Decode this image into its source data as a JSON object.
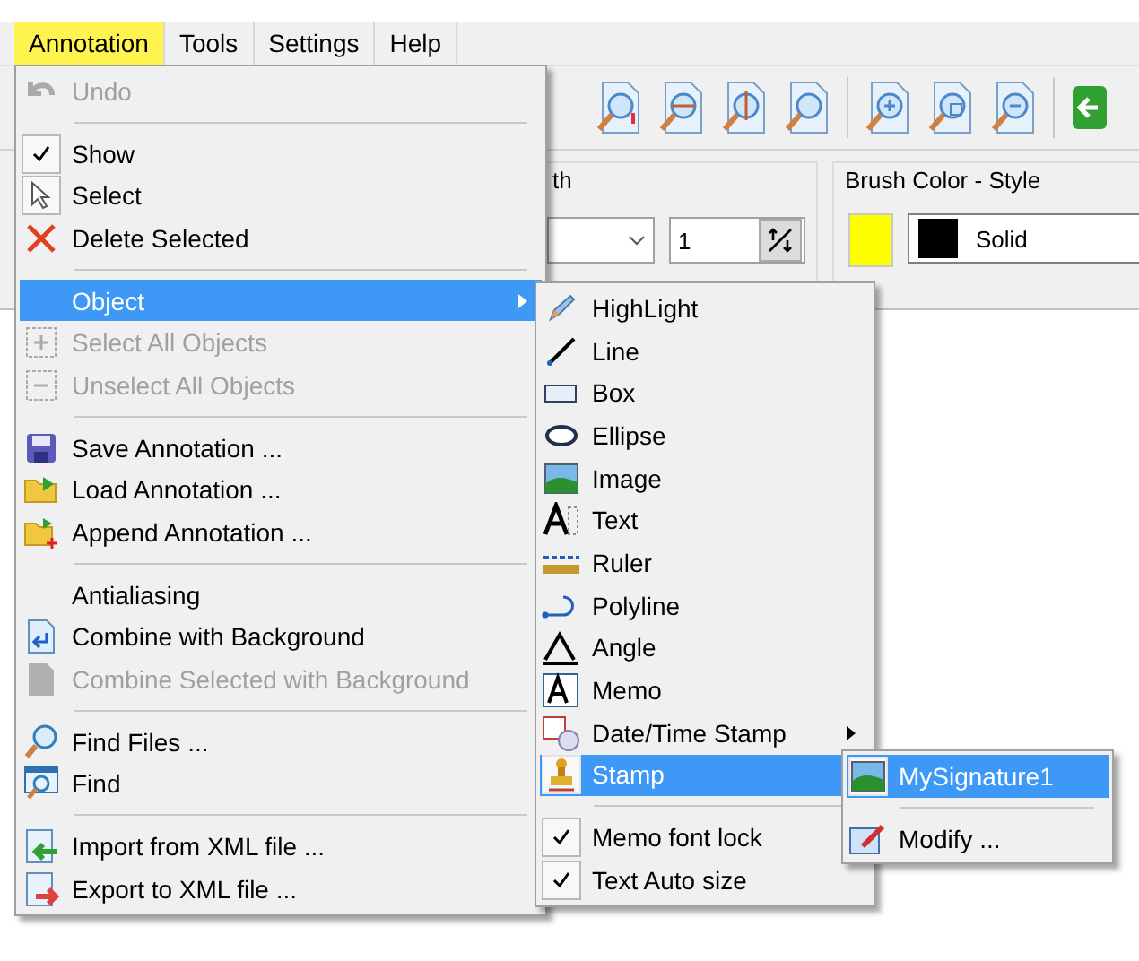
{
  "menubar": [
    {
      "label": "Annotation",
      "selected": true
    },
    {
      "label": "Tools",
      "selected": false
    },
    {
      "label": "Settings",
      "selected": false
    },
    {
      "label": "Help",
      "selected": false
    }
  ],
  "width_group": {
    "title": "th",
    "spin_value": "1"
  },
  "brush_group": {
    "title": "Brush Color - Style",
    "color": "#ffff00",
    "style": "Solid"
  },
  "annotation_menu": [
    {
      "kind": "item",
      "label": "Undo",
      "disabled": true,
      "checked": false,
      "selected": false
    },
    {
      "kind": "separator"
    },
    {
      "kind": "item",
      "label": "Show",
      "disabled": false,
      "checked": true,
      "selected": false
    },
    {
      "kind": "item",
      "label": "Select",
      "disabled": false,
      "checked": true,
      "selected": false
    },
    {
      "kind": "item",
      "label": "Delete Selected",
      "disabled": false,
      "checked": false,
      "selected": false
    },
    {
      "kind": "separator"
    },
    {
      "kind": "submenu",
      "label": "Object",
      "disabled": false,
      "checked": false,
      "selected": true
    },
    {
      "kind": "item",
      "label": "Select All Objects",
      "disabled": true,
      "checked": false,
      "selected": false
    },
    {
      "kind": "item",
      "label": "Unselect All Objects",
      "disabled": true,
      "checked": false,
      "selected": false
    },
    {
      "kind": "separator"
    },
    {
      "kind": "item",
      "label": "Save Annotation ...",
      "disabled": false,
      "checked": false,
      "selected": false
    },
    {
      "kind": "item",
      "label": "Load Annotation ...",
      "disabled": false,
      "checked": false,
      "selected": false
    },
    {
      "kind": "item",
      "label": "Append Annotation ...",
      "disabled": false,
      "checked": false,
      "selected": false
    },
    {
      "kind": "separator"
    },
    {
      "kind": "item",
      "label": "Antialiasing",
      "disabled": false,
      "checked": false,
      "selected": false
    },
    {
      "kind": "item",
      "label": "Combine with Background",
      "disabled": false,
      "checked": false,
      "selected": false
    },
    {
      "kind": "item",
      "label": "Combine Selected with Background",
      "disabled": true,
      "checked": false,
      "selected": false
    },
    {
      "kind": "separator"
    },
    {
      "kind": "item",
      "label": "Find Files ...",
      "disabled": false,
      "checked": false,
      "selected": false
    },
    {
      "kind": "item",
      "label": "Find",
      "disabled": false,
      "checked": false,
      "selected": false
    },
    {
      "kind": "separator"
    },
    {
      "kind": "item",
      "label": "Import from XML file ...",
      "disabled": false,
      "checked": false,
      "selected": false
    },
    {
      "kind": "item",
      "label": "Export to XML file ...",
      "disabled": false,
      "checked": false,
      "selected": false
    }
  ],
  "object_menu": [
    {
      "kind": "item",
      "label": "HighLight",
      "disabled": false,
      "checked": false,
      "selected": false
    },
    {
      "kind": "item",
      "label": "Line",
      "disabled": false,
      "checked": false,
      "selected": false
    },
    {
      "kind": "item",
      "label": "Box",
      "disabled": false,
      "checked": false,
      "selected": false
    },
    {
      "kind": "item",
      "label": "Ellipse",
      "disabled": false,
      "checked": false,
      "selected": false
    },
    {
      "kind": "item",
      "label": "Image",
      "disabled": false,
      "checked": false,
      "selected": false
    },
    {
      "kind": "item",
      "label": "Text",
      "disabled": false,
      "checked": false,
      "selected": false
    },
    {
      "kind": "item",
      "label": "Ruler",
      "disabled": false,
      "checked": false,
      "selected": false
    },
    {
      "kind": "item",
      "label": "Polyline",
      "disabled": false,
      "checked": false,
      "selected": false
    },
    {
      "kind": "item",
      "label": "Angle",
      "disabled": false,
      "checked": false,
      "selected": false
    },
    {
      "kind": "item",
      "label": "Memo",
      "disabled": false,
      "checked": false,
      "selected": false
    },
    {
      "kind": "submenu",
      "label": "Date/Time Stamp",
      "disabled": false,
      "checked": false,
      "selected": false
    },
    {
      "kind": "submenu",
      "label": "Stamp",
      "disabled": false,
      "checked": false,
      "selected": true
    },
    {
      "kind": "separator"
    },
    {
      "kind": "item",
      "label": "Memo font lock",
      "disabled": false,
      "checked": true,
      "selected": false
    },
    {
      "kind": "item",
      "label": "Text Auto size",
      "disabled": false,
      "checked": true,
      "selected": false
    }
  ],
  "stamp_menu": [
    {
      "kind": "item",
      "label": "MySignature1",
      "disabled": false,
      "checked": false,
      "selected": true
    },
    {
      "kind": "separator"
    },
    {
      "kind": "item",
      "label": "Modify ...",
      "disabled": false,
      "checked": false,
      "selected": false
    }
  ]
}
